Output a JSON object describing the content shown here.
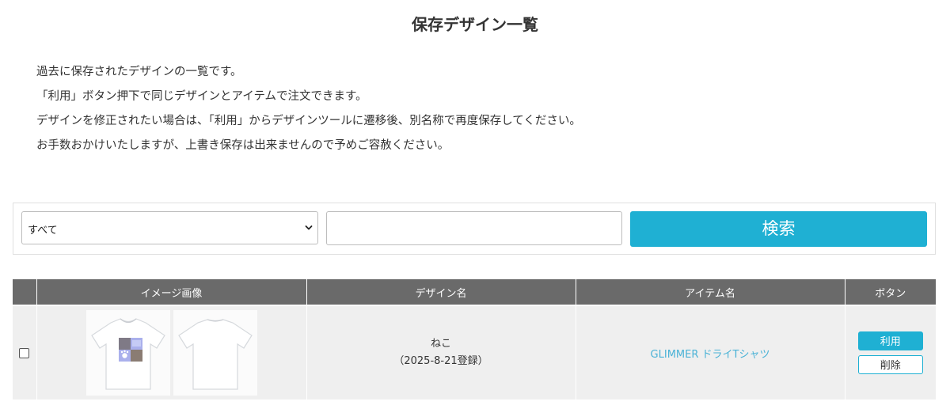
{
  "page": {
    "title": "保存デザイン一覧",
    "description": [
      "過去に保存されたデザインの一覧です。",
      "「利用」ボタン押下で同じデザインとアイテムで注文できます。",
      "デザインを修正されたい場合は、「利用」からデザインツールに遷移後、別名称で再度保存してください。",
      "お手数おかけいたしますが、上書き保存は出来ませんので予めご容赦ください。"
    ]
  },
  "search": {
    "category_selected": "すべて",
    "keyword_value": "",
    "keyword_placeholder": "",
    "button_label": "検索"
  },
  "table": {
    "headers": {
      "checkbox": "",
      "image": "イメージ画像",
      "design_name": "デザイン名",
      "item_name": "アイテム名",
      "buttons": "ボタン"
    },
    "rows": [
      {
        "checked": false,
        "design_name": "ねこ",
        "registered": "（2025-8-21登録）",
        "item_name": "GLIMMER ドライTシャツ",
        "use_label": "利用",
        "delete_label": "削除"
      }
    ]
  },
  "colors": {
    "accent": "#1fb0d3",
    "header_bg": "#6a6a6a",
    "row_bg": "#efefef",
    "link": "#4ab2d6"
  },
  "icons": {
    "select_arrow": "chevron-down-icon",
    "front_print": "tshirt-front-icon",
    "back_print": "tshirt-back-icon"
  }
}
